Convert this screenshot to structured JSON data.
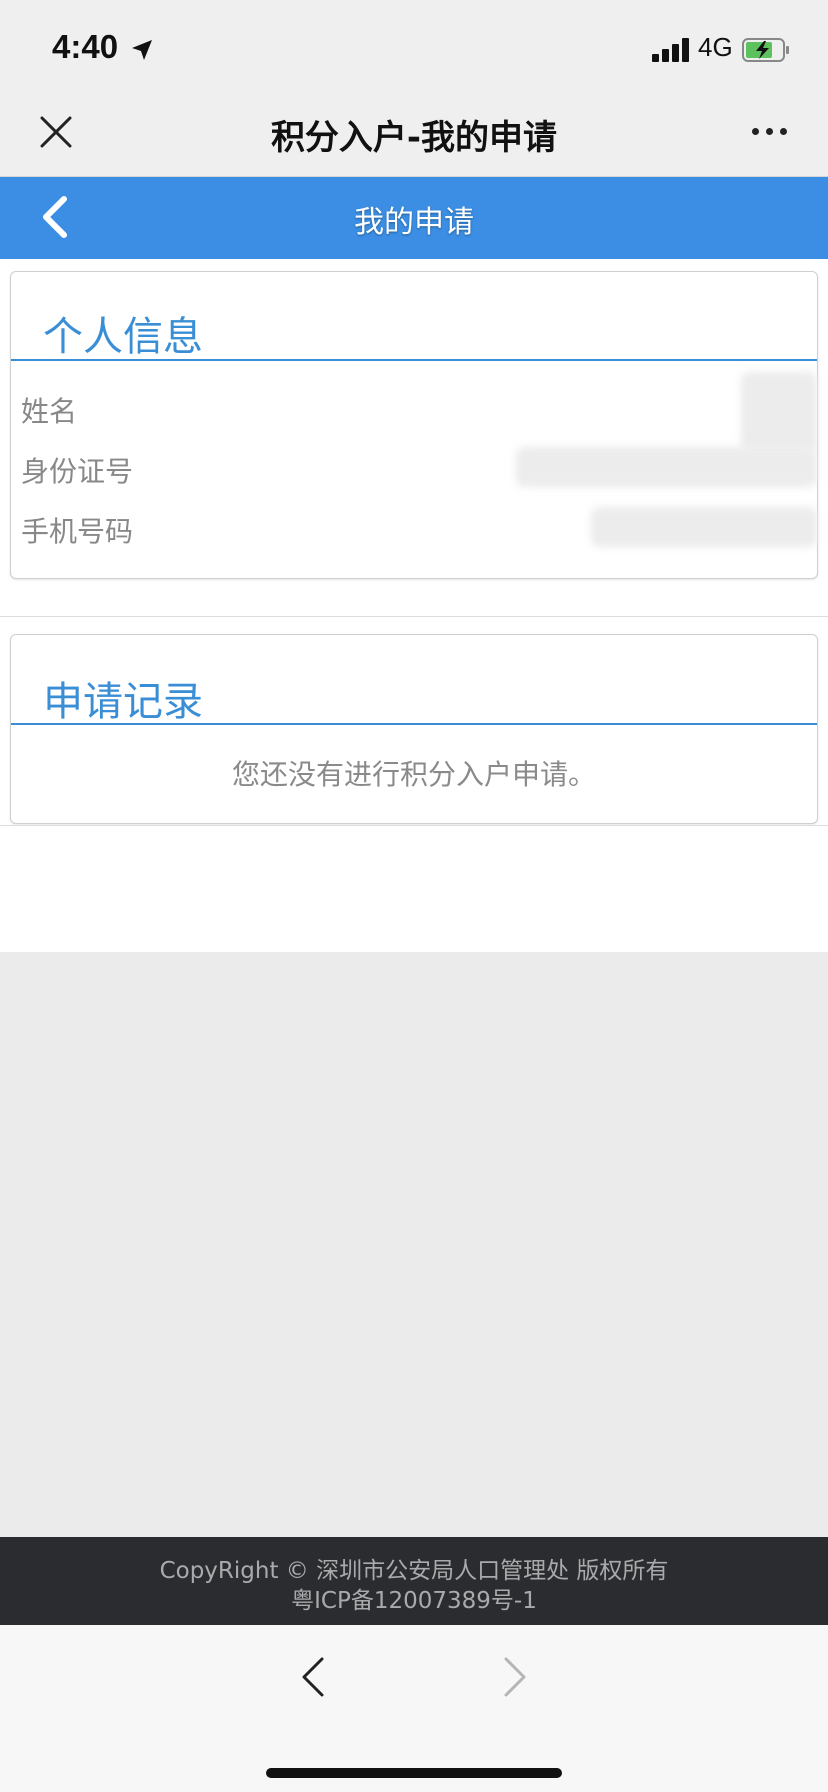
{
  "status_bar": {
    "time": "4:40",
    "network": "4G"
  },
  "nav": {
    "title": "积分入户-我的申请"
  },
  "page": {
    "title": "我的申请"
  },
  "personal_info": {
    "heading": "个人信息",
    "fields": [
      {
        "label": "姓名"
      },
      {
        "label": "身份证号"
      },
      {
        "label": "手机号码"
      }
    ]
  },
  "records": {
    "heading": "申请记录",
    "empty_message": "您还没有进行积分入户申请。"
  },
  "footer": {
    "copyright": "CopyRight © 深圳市公安局人口管理处 版权所有",
    "icp": "粤ICP备12007389号-1"
  },
  "colors": {
    "header_blue": "#3b8ee3",
    "accent_blue": "#3a8ed6",
    "footer_dark": "#2a2c2f"
  }
}
